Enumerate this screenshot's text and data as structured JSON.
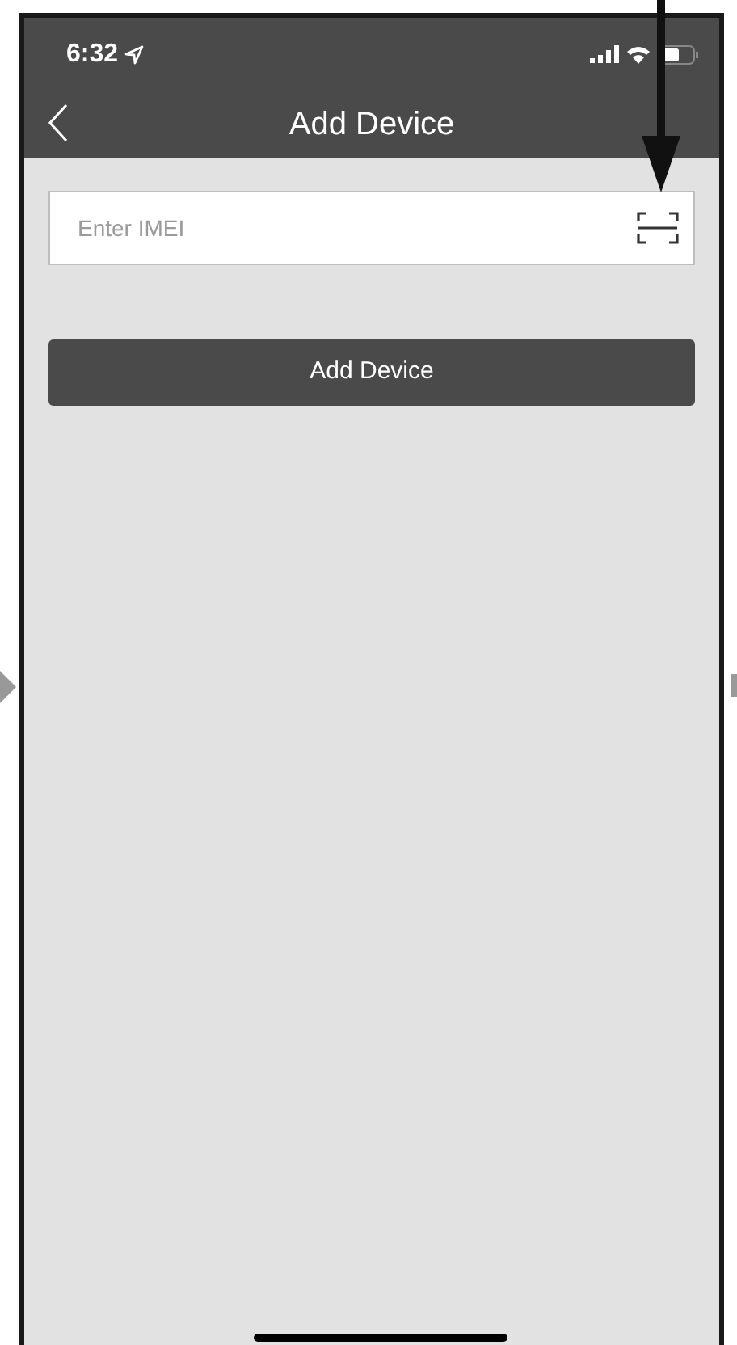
{
  "status_bar": {
    "time": "6:32"
  },
  "nav_bar": {
    "title": "Add Device"
  },
  "imei_field": {
    "placeholder": "Enter IMEI"
  },
  "submit_button": {
    "label": "Add Device"
  }
}
